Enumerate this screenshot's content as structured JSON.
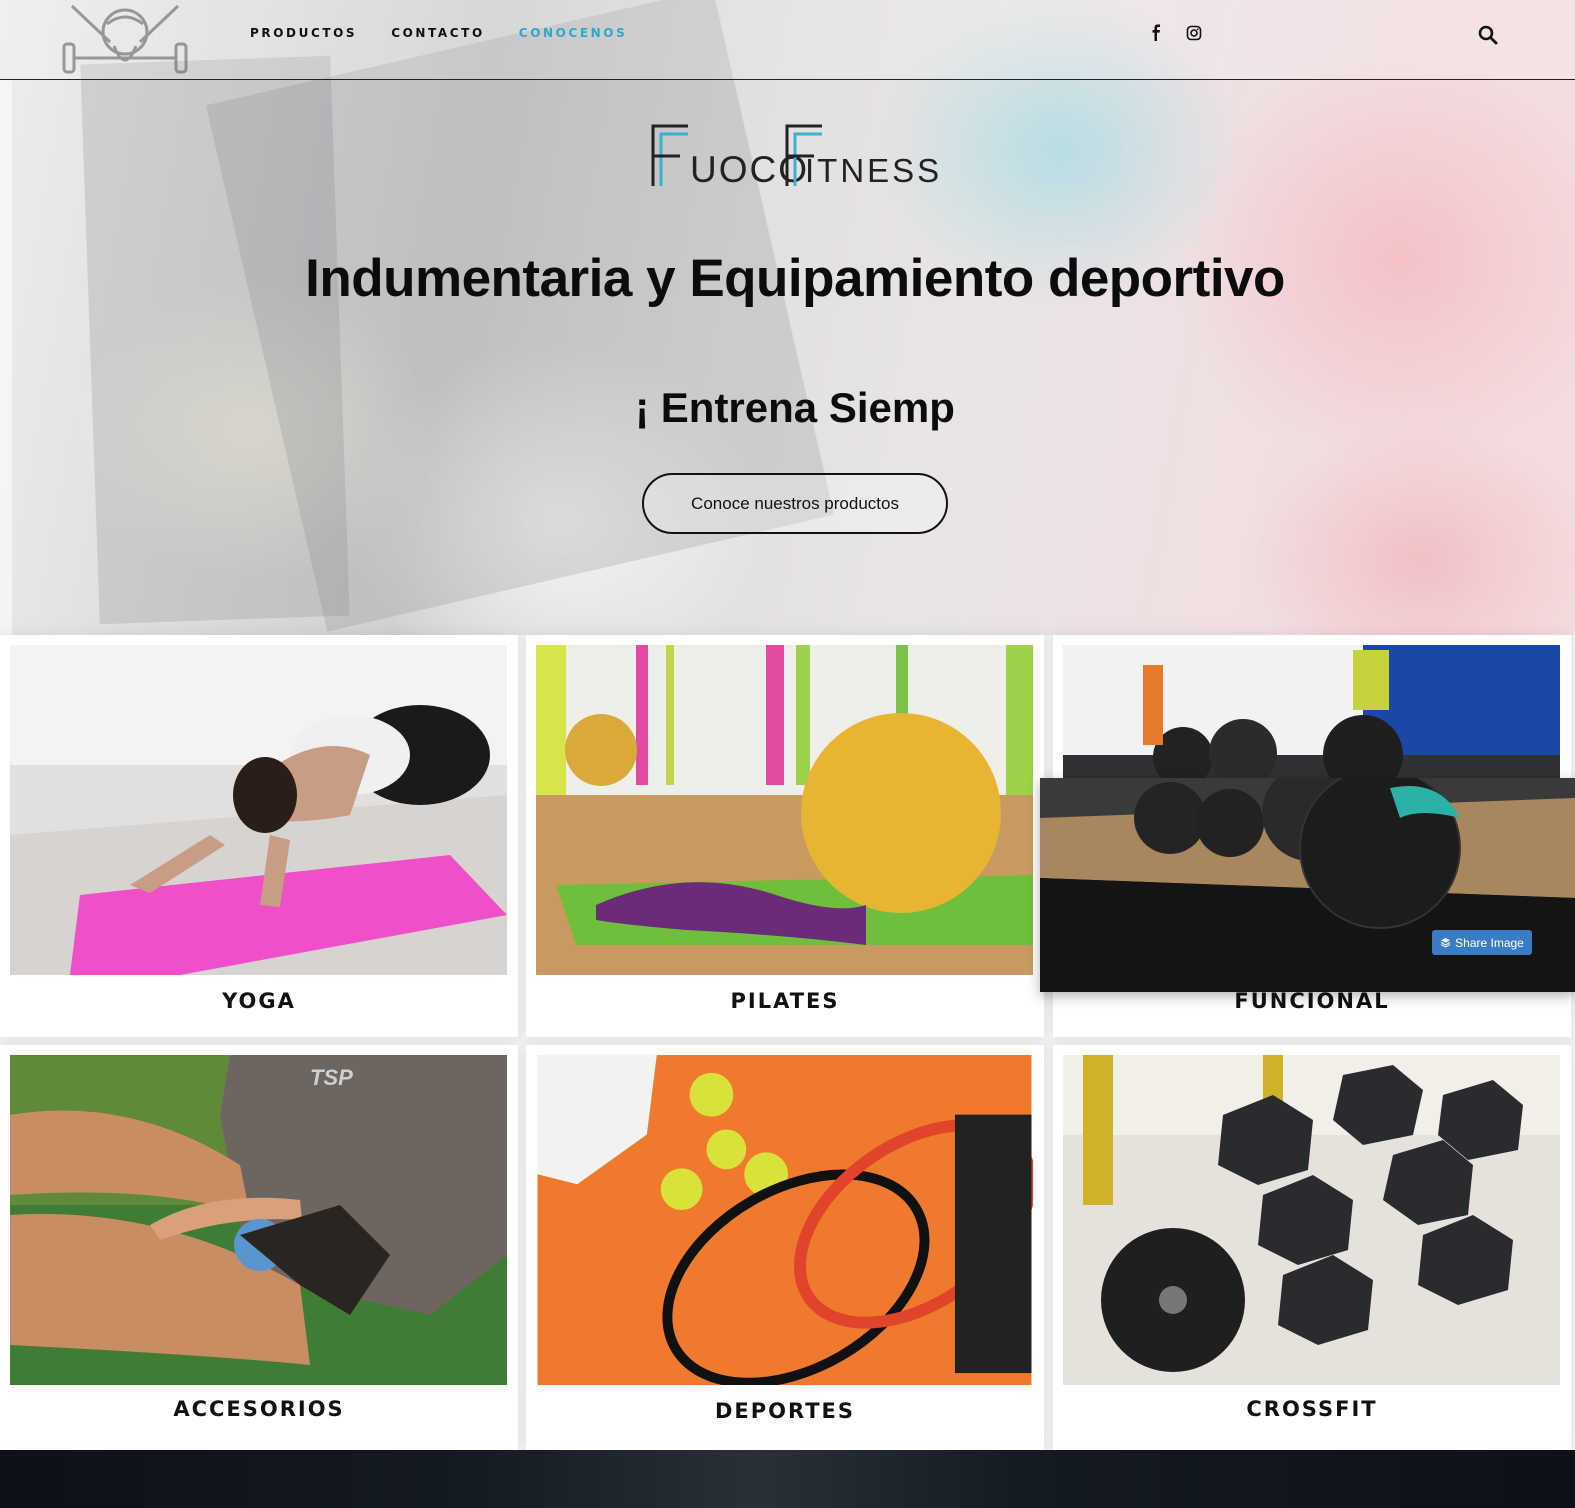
{
  "header": {
    "nav": [
      {
        "label": "PRODUCTOS",
        "active": false
      },
      {
        "label": "CONTACTO",
        "active": false
      },
      {
        "label": "CONOCENOS",
        "active": true
      }
    ],
    "social": [
      "facebook-icon",
      "instagram-icon"
    ],
    "search_icon": "search-icon",
    "accent_color": "#2fa8c8"
  },
  "hero": {
    "brand_part1": "UOCO",
    "brand_part2": "ITNESS",
    "title": "Indumentaria y Equipamiento deportivo",
    "subtitle": "¡ Entrena Siemp",
    "cta_label": "Conoce nuestros productos"
  },
  "categories": [
    {
      "label": "YOGA"
    },
    {
      "label": "PILATES"
    },
    {
      "label": "FUNCIONAL"
    },
    {
      "label": "ACCESORIOS"
    },
    {
      "label": "DEPORTES"
    },
    {
      "label": "CROSSFIT"
    }
  ],
  "popup": {
    "share_label": "Share Image",
    "share_color": "#3a7cc4"
  }
}
